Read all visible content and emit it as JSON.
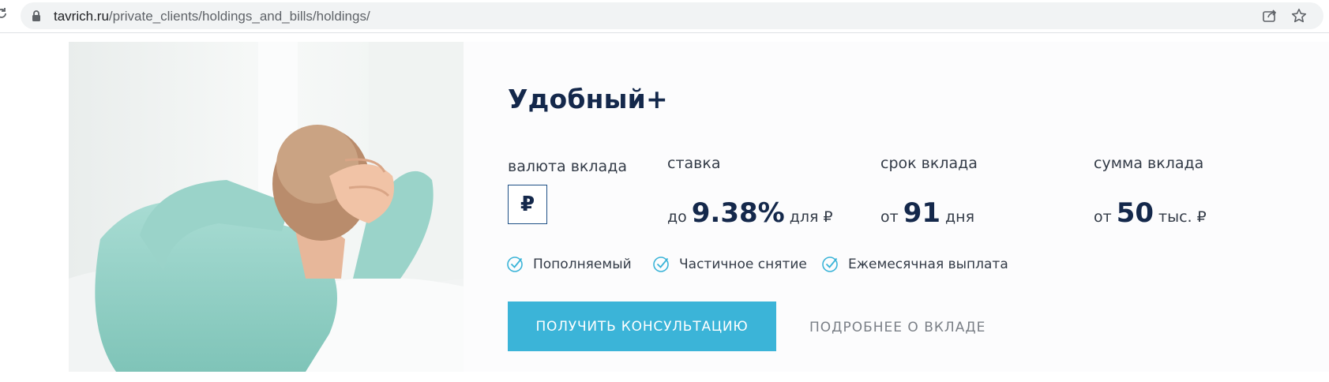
{
  "browser": {
    "url_host": "tavrich.ru",
    "url_path": "/private_clients/holdings_and_bills/holdings/"
  },
  "deposit": {
    "title": "Удобный+",
    "currency_label": "валюта вклада",
    "currency_symbol": "₽",
    "rate": {
      "label": "ставка",
      "prefix": "до",
      "value": "9.38%",
      "suffix": "для ₽"
    },
    "term": {
      "label": "срок вклада",
      "prefix": "от",
      "value": "91",
      "suffix": "дня"
    },
    "amount": {
      "label": "сумма вклада",
      "prefix": "от",
      "value": "50",
      "suffix": "тыс. ₽"
    },
    "features": [
      "Пополняемый",
      "Частичное снятие",
      "Ежемесячная выплата"
    ],
    "cta_label": "ПОЛУЧИТЬ КОНСУЛЬТАЦИЮ",
    "details_label": "ПОДРОБНЕЕ О ВКЛАДЕ"
  },
  "colors": {
    "accent": "#3bb4d8",
    "title": "#14284b",
    "text": "#333b47",
    "muted": "#7a7f86"
  },
  "icons": {
    "reload": "reload-icon",
    "lock": "lock-icon",
    "share": "share-icon",
    "bookmark": "star-icon",
    "feature": "check-circle-icon"
  }
}
